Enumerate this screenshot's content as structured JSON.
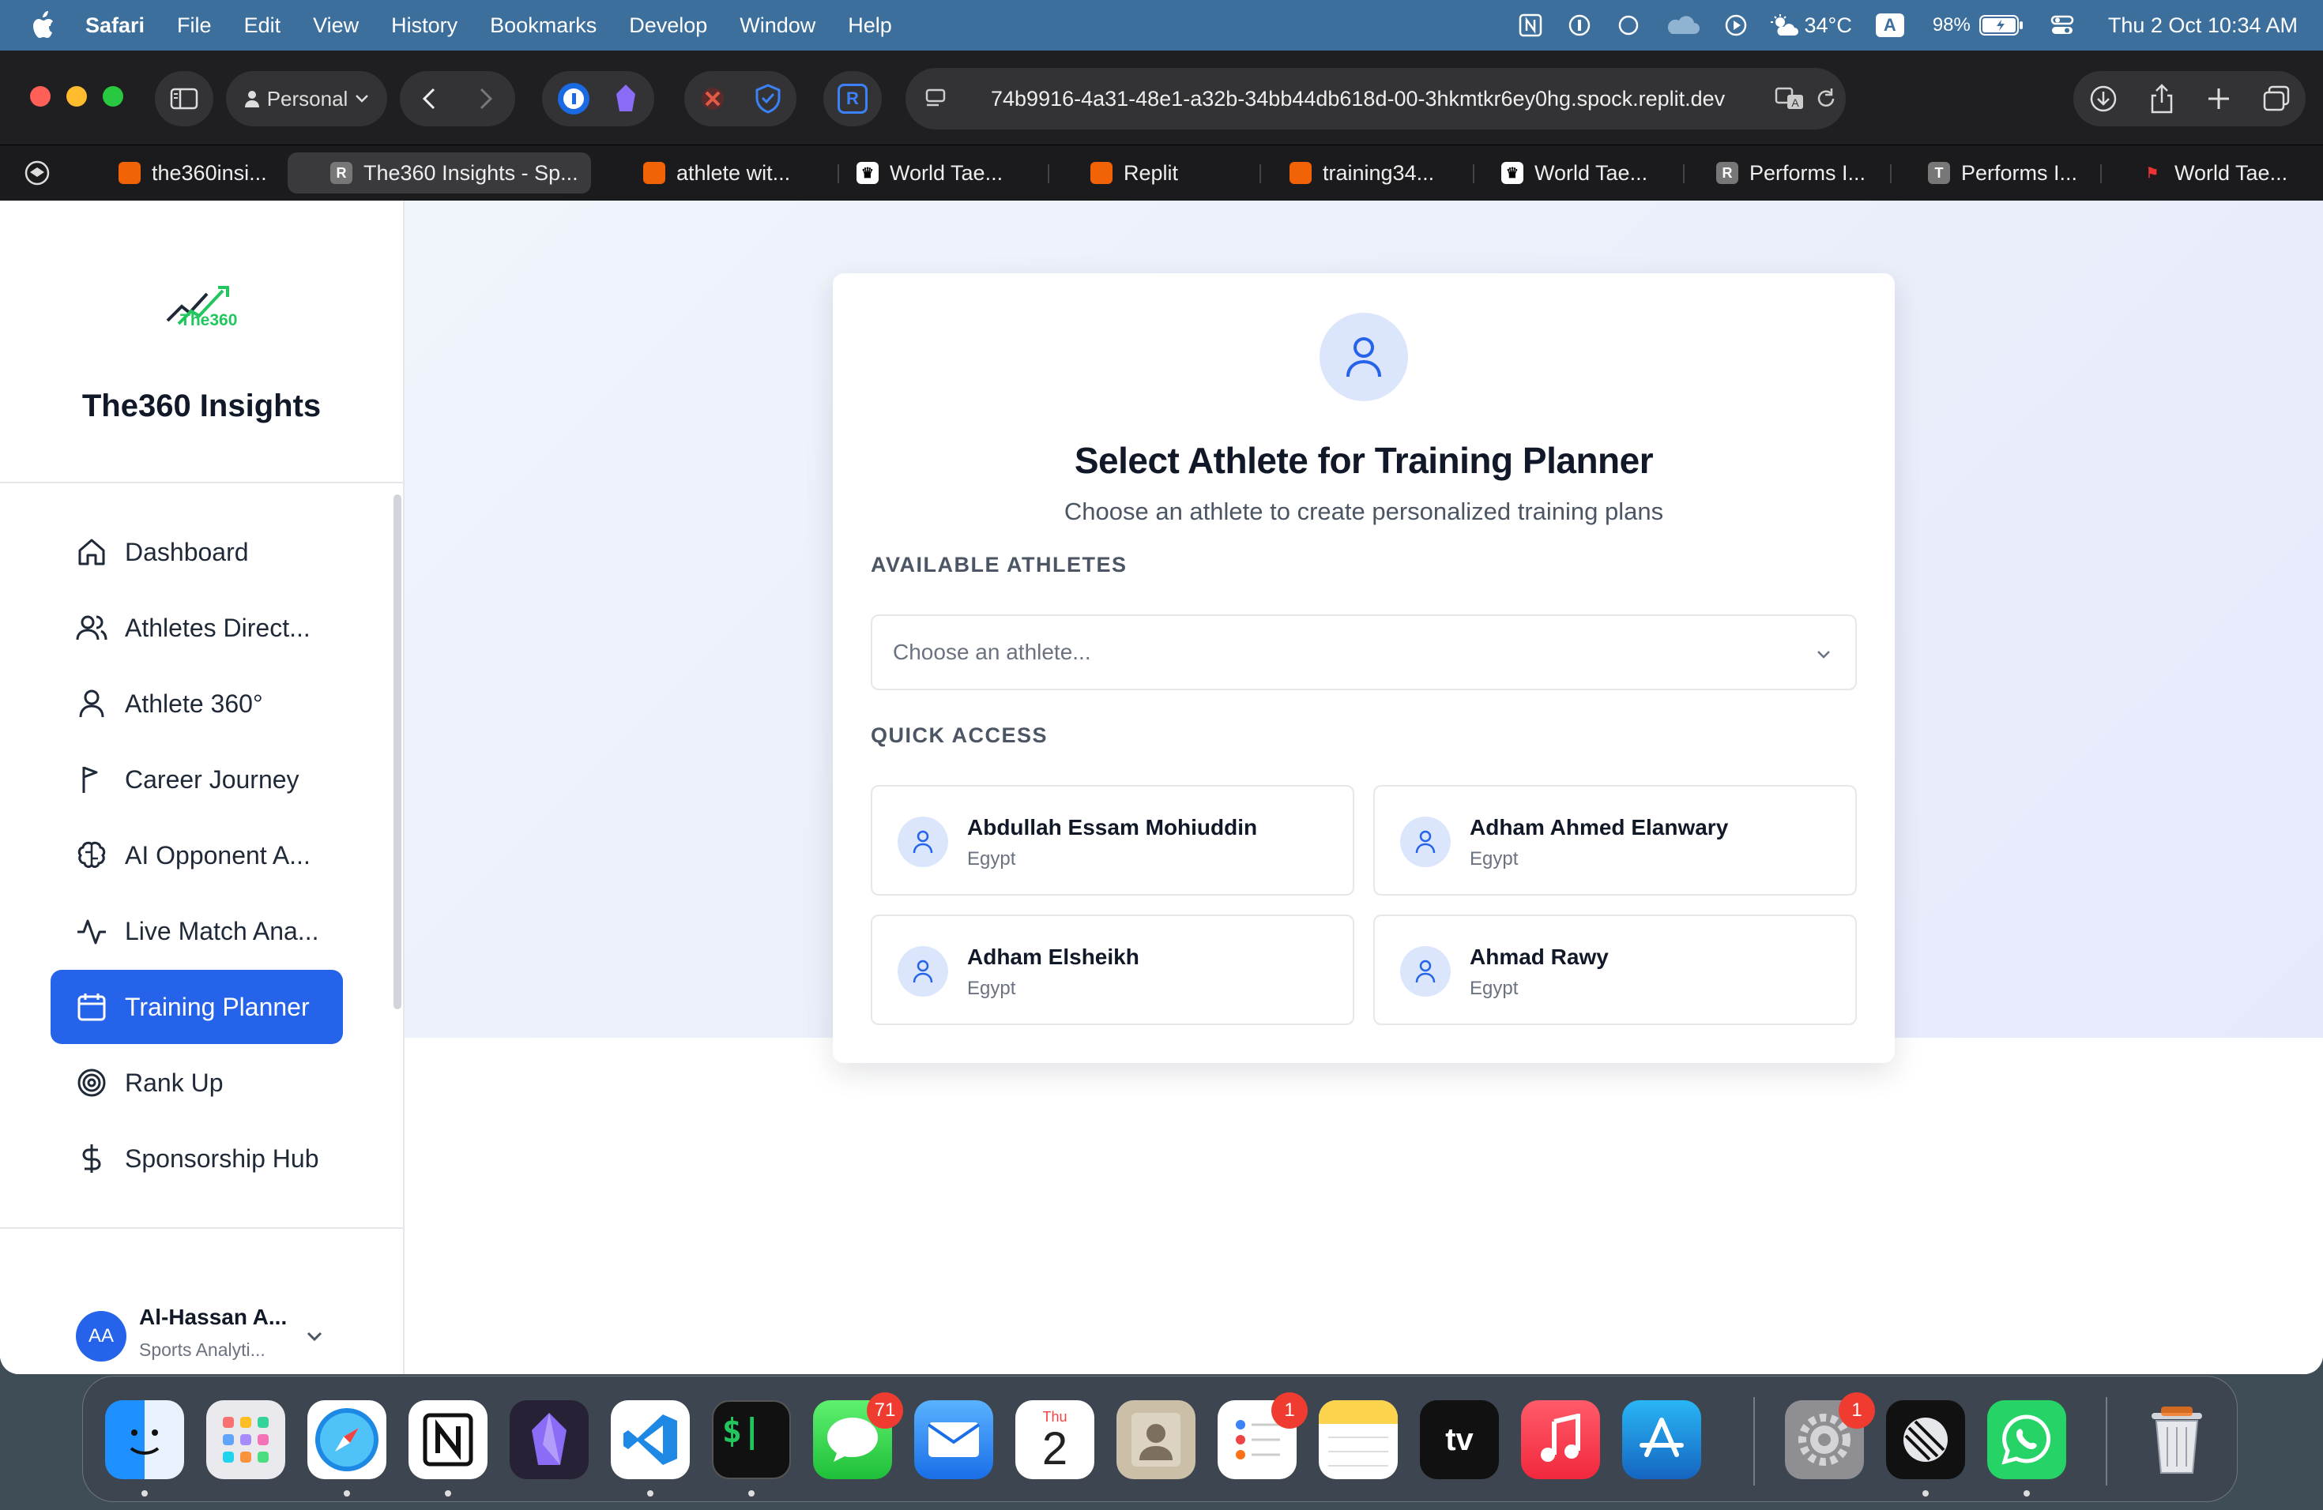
{
  "menubar": {
    "app": "Safari",
    "menus": [
      "File",
      "Edit",
      "View",
      "History",
      "Bookmarks",
      "Develop",
      "Window",
      "Help"
    ],
    "temperature": "34°C",
    "input_source": "A",
    "battery": "98%",
    "datetime": "Thu 2 Oct  10:34 AM"
  },
  "browser": {
    "profile": "Personal",
    "url": "74b9916-4a31-48e1-a32b-34bb44db618d-00-3hkmtkr6ey0hg.spock.replit.dev",
    "tabs": [
      {
        "label": "the360insi...",
        "icon": "replit-icon",
        "active": false
      },
      {
        "label": "The360 Insights - Sp...",
        "icon": "r-icon",
        "active": true
      },
      {
        "label": "athlete wit...",
        "icon": "replit-icon",
        "active": false
      },
      {
        "label": "World Tae...",
        "icon": "crown-icon",
        "active": false
      },
      {
        "label": "Replit",
        "icon": "replit-icon",
        "active": false
      },
      {
        "label": "training34...",
        "icon": "replit-icon",
        "active": false
      },
      {
        "label": "World Tae...",
        "icon": "crown-icon",
        "active": false
      },
      {
        "label": "Performs I...",
        "icon": "r-icon",
        "active": false
      },
      {
        "label": "Performs I...",
        "icon": "t-icon",
        "active": false
      },
      {
        "label": "World Tae...",
        "icon": "wt-icon",
        "active": false
      }
    ]
  },
  "sidebar": {
    "logo_text": "The360",
    "brand": "The360 Insights",
    "items": [
      {
        "label": "Dashboard",
        "icon": "home-icon"
      },
      {
        "label": "Athletes Direct...",
        "icon": "users-icon"
      },
      {
        "label": "Athlete 360°",
        "icon": "user-icon"
      },
      {
        "label": "Career Journey",
        "icon": "flag-icon"
      },
      {
        "label": "AI Opponent A...",
        "icon": "brain-icon"
      },
      {
        "label": "Live Match Ana...",
        "icon": "activity-icon"
      },
      {
        "label": "Training Planner",
        "icon": "calendar-icon",
        "active": true
      },
      {
        "label": "Rank Up",
        "icon": "target-icon"
      },
      {
        "label": "Sponsorship Hub",
        "icon": "dollar-icon"
      }
    ],
    "user": {
      "initials": "AA",
      "name": "Al-Hassan A...",
      "role": "Sports Analyti..."
    }
  },
  "main": {
    "title": "Select Athlete for Training Planner",
    "subtitle": "Choose an athlete to create personalized training plans",
    "available_label": "AVAILABLE ATHLETES",
    "select_placeholder": "Choose an athlete...",
    "quick_label": "QUICK ACCESS",
    "athletes": [
      {
        "name": "Abdullah Essam Mohiuddin",
        "country": "Egypt"
      },
      {
        "name": "Adham Ahmed Elanwary",
        "country": "Egypt"
      },
      {
        "name": "Adham Elsheikh",
        "country": "Egypt"
      },
      {
        "name": "Ahmad Rawy",
        "country": "Egypt"
      }
    ]
  },
  "dock": {
    "calendar_day": "Thu",
    "calendar_date": "2",
    "badges": {
      "messages": "71",
      "reminders": "1",
      "settings": "1"
    }
  },
  "colors": {
    "accent": "#2563eb",
    "menubar": "#3c6f9c",
    "icon_bg": "#dbe6fd"
  }
}
